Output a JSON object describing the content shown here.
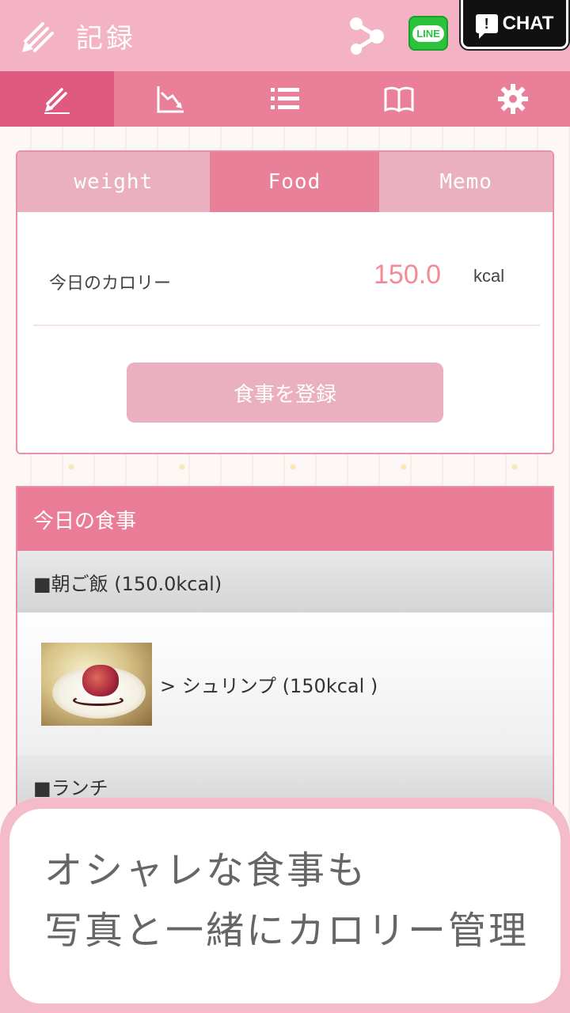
{
  "header": {
    "title": "記録",
    "line_label": "LINE",
    "chat_label": "CHAT",
    "chat_glyph": "!"
  },
  "nav": {
    "items": [
      {
        "icon": "pencil-icon",
        "active": true
      },
      {
        "icon": "graph-down-icon",
        "active": false
      },
      {
        "icon": "list-icon",
        "active": false
      },
      {
        "icon": "book-icon",
        "active": false
      },
      {
        "icon": "gear-icon",
        "active": false
      }
    ]
  },
  "record": {
    "tabs": [
      "weight",
      "Food",
      "Memo"
    ],
    "active_tab": "Food",
    "calorie_label": "今日のカロリー",
    "calorie_value": "150.0",
    "calorie_unit": "kcal",
    "register_label": "食事を登録"
  },
  "meals": {
    "header": "今日の食事",
    "sections": [
      {
        "title": "■朝ご飯 (150.0kcal)",
        "items": [
          {
            "label": "> シュリンプ (150kcal )"
          }
        ]
      },
      {
        "title": "■ランチ",
        "items": []
      }
    ]
  },
  "caption": {
    "line1": "オシャレな食事も",
    "line2": "写真と一緒にカロリー管理"
  },
  "colors": {
    "header_bg": "#f4b3c4",
    "nav_bg": "#ea7f9a",
    "accent_pink": "#e97c96",
    "calorie_value": "#f48a92",
    "line_green": "#2bc33b"
  }
}
